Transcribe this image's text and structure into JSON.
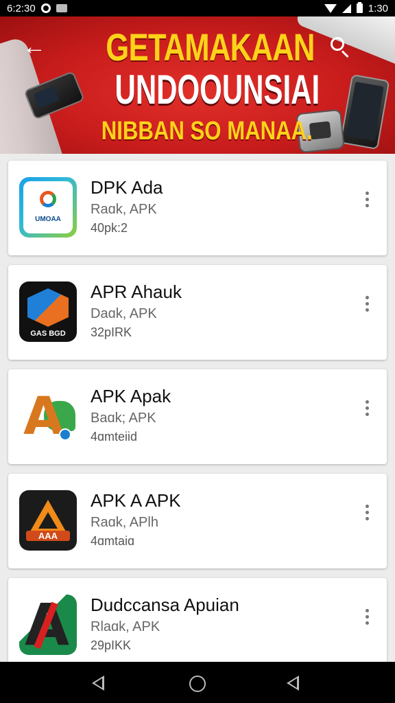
{
  "status_bar": {
    "time_left": "6:2:30",
    "time_right": "1:30",
    "icons": [
      "circle-icon",
      "image-icon",
      "wifi-icon",
      "signal-icon",
      "battery-icon"
    ]
  },
  "banner": {
    "line1": "GETAMAKAAN",
    "line2": "UNDOOUNSIAI",
    "line3": "NIBBAN SO MANAA.",
    "back_icon": "arrow-left-icon",
    "search_icon": "search-icon",
    "colors": {
      "background": "#c81c1c",
      "headline_yellow": "#ffd21a",
      "headline_white": "#ffffff"
    }
  },
  "apps": [
    {
      "name": "DPK Ada",
      "subtitle": "Raɑk, APK",
      "meta": "40pk:2",
      "icon_label": "UMOAA"
    },
    {
      "name": "APR Ahauk",
      "subtitle": "Daɑk, APK",
      "meta": "32pIRK",
      "icon_label": "GAS BGD"
    },
    {
      "name": "APK Apak",
      "subtitle": "Baɑk; APK",
      "meta": "4ɑmteiid",
      "icon_label": ""
    },
    {
      "name": "APK A APK",
      "subtitle": "Raɑk, APlh",
      "meta": "4ɑmtaiɑ",
      "icon_label": "AAA"
    },
    {
      "name": "Dudccansa Apuian",
      "subtitle": "Rlaɑk, APK",
      "meta": "29pIKK",
      "icon_label": ""
    }
  ],
  "nav_bar": {
    "icons": [
      "nav-back-icon",
      "nav-home-icon",
      "nav-recent-icon"
    ]
  }
}
